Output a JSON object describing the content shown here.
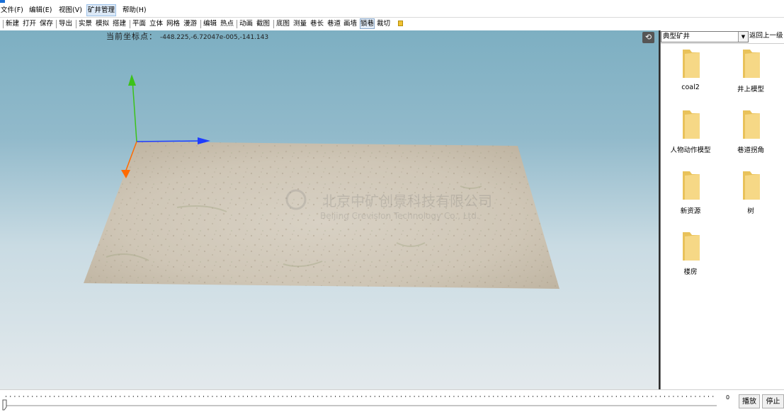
{
  "menu": {
    "items": [
      {
        "label": "文件(F)"
      },
      {
        "label": "编辑(E)"
      },
      {
        "label": "视图(V)"
      },
      {
        "label": "矿井管理"
      },
      {
        "label": "帮助(H)"
      }
    ]
  },
  "toolbar": {
    "buttons": [
      {
        "label": "新建"
      },
      {
        "label": "打开"
      },
      {
        "label": "保存"
      },
      {
        "label": "导出"
      },
      {
        "label": "实景"
      },
      {
        "label": "模拟"
      },
      {
        "label": "搭建"
      },
      {
        "label": "平面"
      },
      {
        "label": "立体"
      },
      {
        "label": "网格"
      },
      {
        "label": "漫游"
      },
      {
        "label": "编辑"
      },
      {
        "label": "热点"
      },
      {
        "label": "动画"
      },
      {
        "label": "截图"
      },
      {
        "label": "底图"
      },
      {
        "label": "测量"
      },
      {
        "label": "巷长"
      },
      {
        "label": "巷道"
      },
      {
        "label": "画墙"
      },
      {
        "label": "锁巷"
      },
      {
        "label": "裁切"
      }
    ]
  },
  "viewport": {
    "coord_label": "当前坐标点：",
    "coord_value": "-448.225,-6.72047e-005,-141.143",
    "watermark_cn": "北京中矿创景科技有限公司",
    "watermark_en": "Beijing Crevision Technology Co., Ltd.",
    "axis_colors": {
      "x": "#1f3cff",
      "y": "#3cc21a",
      "z": "#ff6a00"
    }
  },
  "panel": {
    "category": "典型矿井",
    "back_label": "返回上一级",
    "folders": [
      {
        "label": "coal2"
      },
      {
        "label": "井上模型"
      },
      {
        "label": "人物动作模型"
      },
      {
        "label": "巷道拐角"
      },
      {
        "label": "新资源"
      },
      {
        "label": "树"
      },
      {
        "label": "楼房"
      }
    ]
  },
  "timeline": {
    "value": "0",
    "play_label": "播放",
    "stop_label": "停止"
  }
}
